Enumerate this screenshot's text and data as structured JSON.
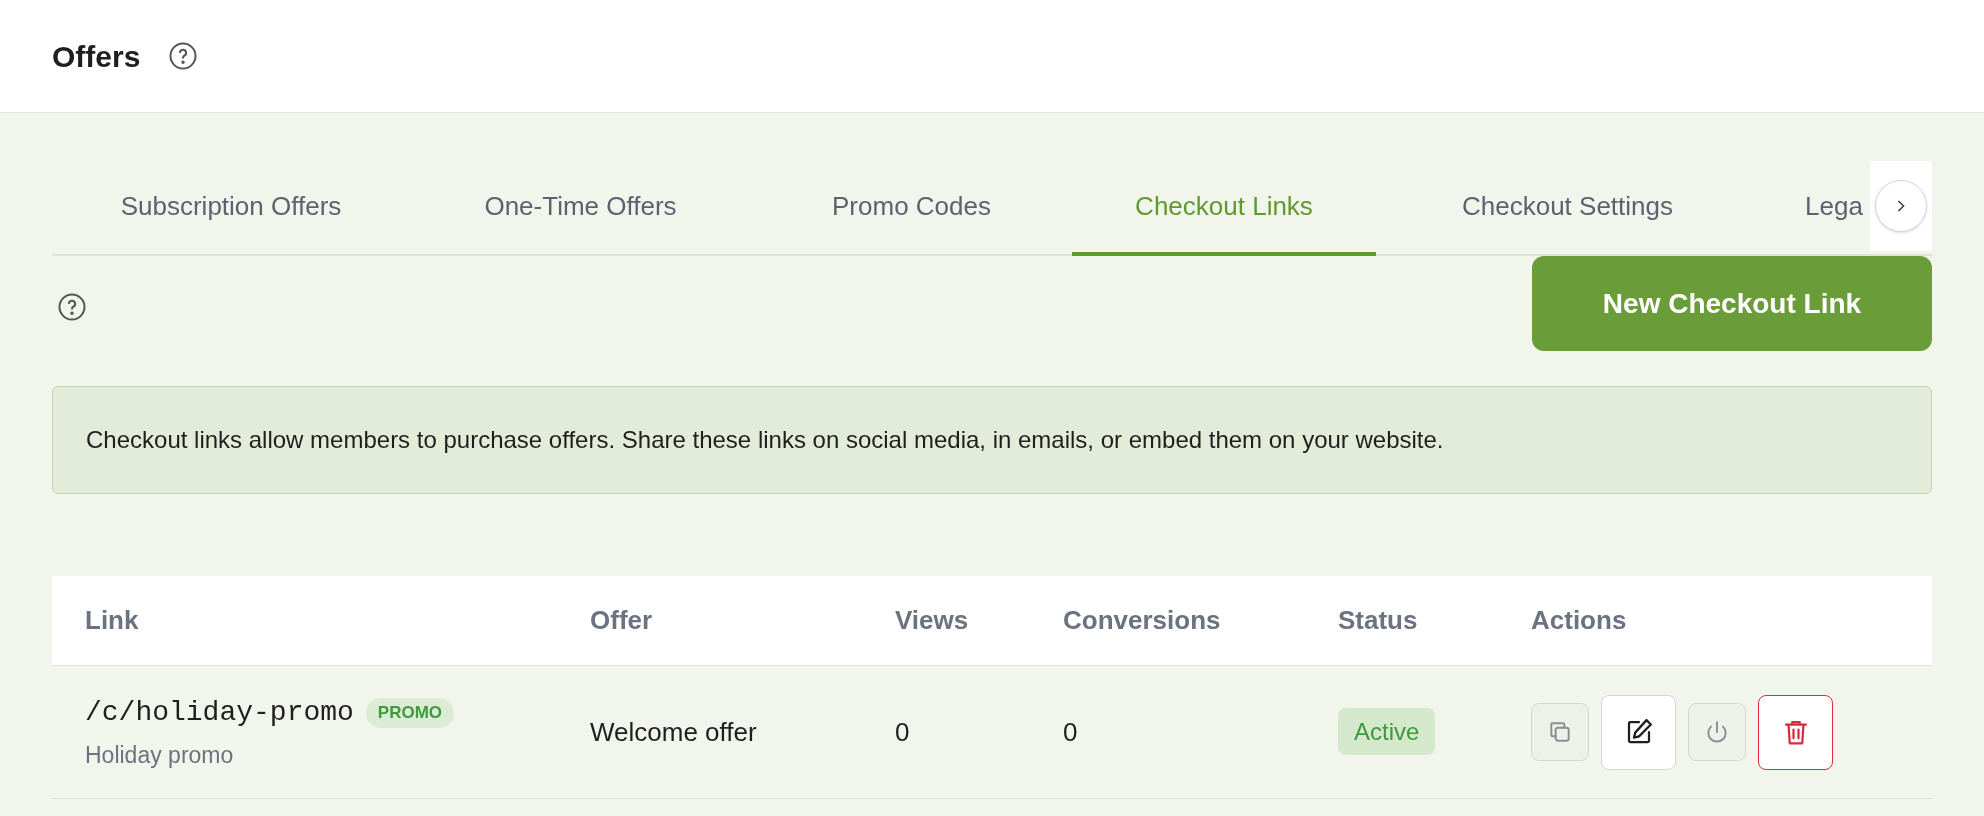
{
  "header": {
    "title": "Offers"
  },
  "tabs": [
    {
      "label": "Subscription Offers",
      "selected": false
    },
    {
      "label": "One-Time Offers",
      "selected": false
    },
    {
      "label": "Promo Codes",
      "selected": false
    },
    {
      "label": "Checkout Links",
      "selected": true
    },
    {
      "label": "Checkout Settings",
      "selected": false
    },
    {
      "label": "Lega",
      "selected": false
    }
  ],
  "new_button": "New Checkout Link",
  "info": "Checkout links allow members to purchase offers. Share these links on social media, in emails, or embed them on your website.",
  "table": {
    "columns": [
      "Link",
      "Offer",
      "Views",
      "Conversions",
      "Status",
      "Actions"
    ],
    "rows": [
      {
        "link": "/c/holiday-promo",
        "badge": "PROMO",
        "name": "Holiday promo",
        "offer": "Welcome offer",
        "views": "0",
        "conversions": "0",
        "status": "Active",
        "actions": [
          {
            "kind": "copy",
            "disabled": true
          },
          {
            "kind": "edit",
            "disabled": false
          },
          {
            "kind": "power",
            "disabled": true
          },
          {
            "kind": "delete",
            "disabled": false
          }
        ]
      }
    ]
  }
}
